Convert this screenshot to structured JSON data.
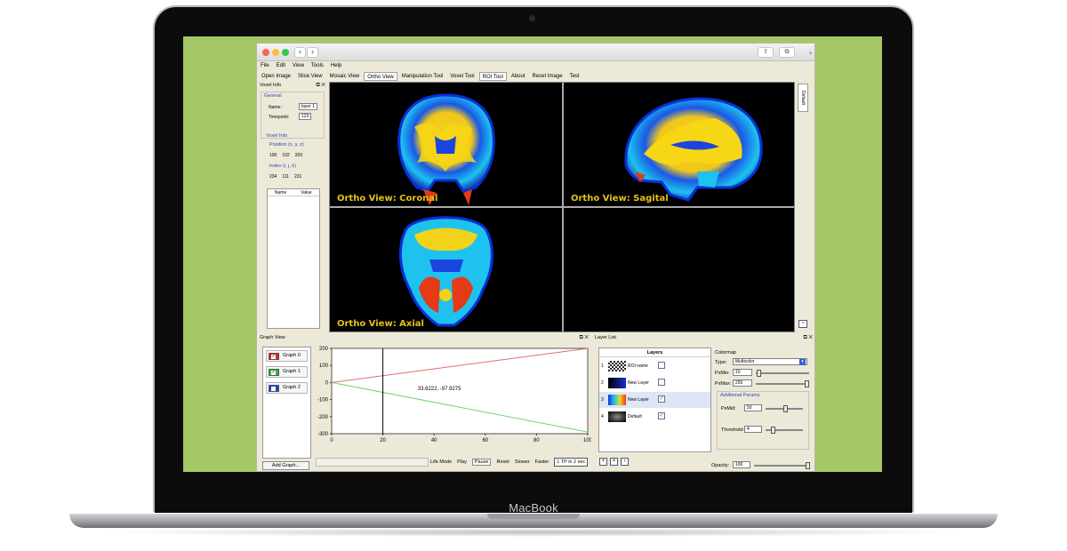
{
  "device": {
    "brand": "MacBook"
  },
  "menu": [
    "File",
    "Edit",
    "View",
    "Tools",
    "Help"
  ],
  "toolbar": [
    "Open Image",
    "Slice View",
    "Mosaic View",
    "Ortho View",
    "Manipulation Tool",
    "Voxel Tool",
    "ROI Tool",
    "About",
    "Reset Image",
    "Test"
  ],
  "voxel_info": {
    "title": "Voxel Info",
    "general_title": "General",
    "name_label": "Name:",
    "name_value": "layer 1",
    "timepoint_label": "Timepoint:",
    "timepoint_value": "123",
    "voxel_info_title": "Voxel Info",
    "position_title": "Position (x, y, z)",
    "position": [
      "100",
      "102",
      "203"
    ],
    "index_title": "Index (i, j, k)",
    "index": [
      "234",
      "111",
      "231"
    ],
    "table_headers": [
      "Name",
      "Value"
    ]
  },
  "views": {
    "coronal": "Ortho View: Coronal",
    "sagital": "Ortho View: Sagital",
    "axial": "Ortho View: Axial"
  },
  "right_tab": "Default",
  "graph_view": {
    "title": "Graph View",
    "graphs": [
      {
        "name": "Graph 0",
        "color": "#e0231c"
      },
      {
        "name": "Graph 1",
        "color": "#2fbd2a"
      },
      {
        "name": "Graph 2",
        "color": "#1f3fd6"
      }
    ],
    "add_button": "Add Graph...",
    "controls": {
      "life_mode": "Life Mode",
      "play": "Play",
      "pause": "Pause",
      "reset": "Reset",
      "slower": "Slower",
      "faster": "Faster",
      "tp": "1 TP in 2 sec"
    }
  },
  "chart_data": {
    "type": "line",
    "xlim": [
      0,
      100
    ],
    "ylim": [
      -300,
      200
    ],
    "x_ticks": [
      0,
      20,
      40,
      60,
      80,
      100
    ],
    "y_ticks": [
      200,
      100,
      0,
      -100,
      -200,
      -300
    ],
    "series": [
      {
        "color": "#e36b6b",
        "x": [
          0,
          100
        ],
        "y": [
          0,
          200
        ]
      },
      {
        "color": "#6fd66f",
        "x": [
          0,
          100
        ],
        "y": [
          0,
          -290
        ]
      }
    ],
    "cursor_x": 20,
    "annotation": "33.6222, -97.9275",
    "annotation_at": [
      33.6,
      -45
    ]
  },
  "layer_list": {
    "title": "Layer List",
    "header": "Layers",
    "layers": [
      {
        "num": "1",
        "name": "ROI name",
        "checked": false
      },
      {
        "num": "2",
        "name": "New Layer",
        "checked": false
      },
      {
        "num": "3",
        "name": "New Layer",
        "checked": true
      },
      {
        "num": "4",
        "name": "Default",
        "checked": true
      }
    ],
    "check_mark": "✓"
  },
  "colormap": {
    "title": "Colormap",
    "type_label": "Type:",
    "type_value": "Multicolor",
    "pxmin_label": "PxMin:",
    "pxmin_value": "10",
    "pxmax_label": "PxMax:",
    "pxmax_value": "255",
    "additional_title": "Additional Params",
    "pxmid_label": "PxMid:",
    "pxmid_value": "50",
    "threshold_label": "Threshold:",
    "threshold_value": "4",
    "opacity_label": "Opacity:",
    "opacity_value": "100"
  }
}
